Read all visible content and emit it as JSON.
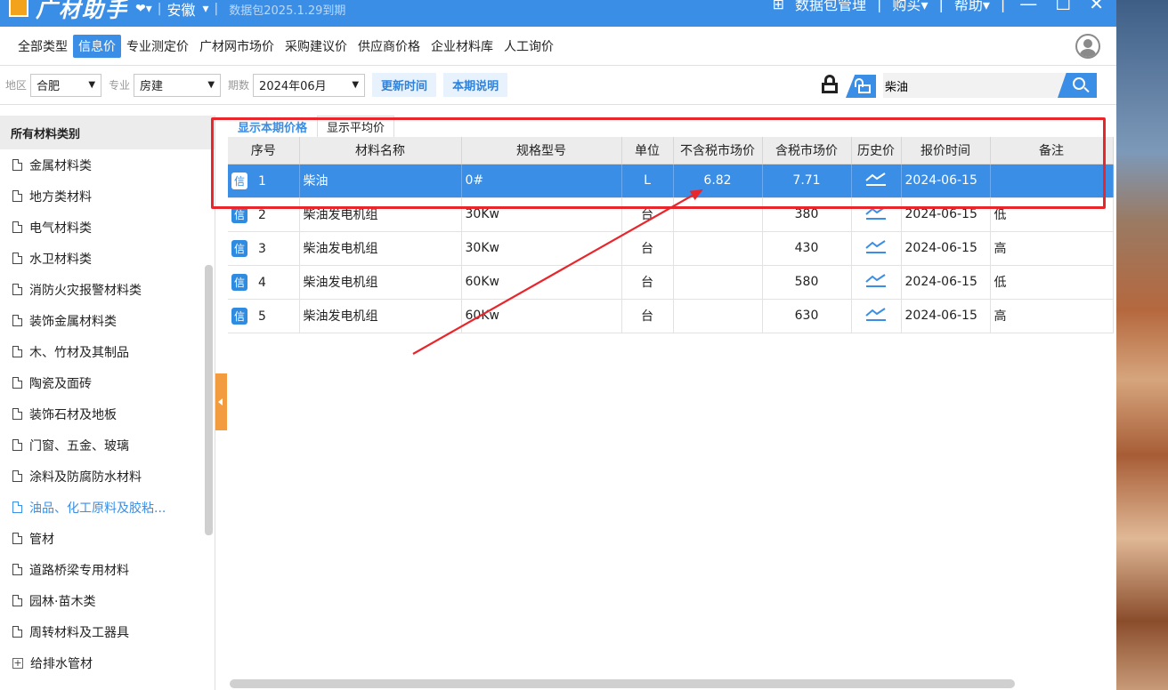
{
  "window": {
    "app_name": "广材助手",
    "region": "安徽",
    "expire_text": "数据包2025.1.29到期",
    "right_menu": [
      "数据包管理",
      "购买",
      "帮助"
    ],
    "win_controls": [
      "—",
      "☐",
      "✕"
    ]
  },
  "menubar": {
    "items": [
      "全部类型",
      "信息价",
      "专业测定价",
      "广材网市场价",
      "采购建议价",
      "供应商价格",
      "企业材料库",
      "人工询价"
    ],
    "active_index": 1
  },
  "filters": {
    "region_label": "地区",
    "region_value": "合肥",
    "major_label": "专业",
    "major_value": "房建",
    "period_label": "期数",
    "period_value": "2024年06月",
    "update_time_label": "更新时间",
    "period_note_label": "本期说明",
    "search_value": "柴油"
  },
  "sidebar": {
    "header": "所有材料类别",
    "items": [
      {
        "label": "金属材料类",
        "type": "doc"
      },
      {
        "label": "地方类材料",
        "type": "doc"
      },
      {
        "label": "电气材料类",
        "type": "doc"
      },
      {
        "label": "水卫材料类",
        "type": "doc"
      },
      {
        "label": "消防火灾报警材料类",
        "type": "doc"
      },
      {
        "label": "装饰金属材料类",
        "type": "doc"
      },
      {
        "label": "木、竹材及其制品",
        "type": "doc"
      },
      {
        "label": "陶瓷及面砖",
        "type": "doc"
      },
      {
        "label": "装饰石材及地板",
        "type": "doc"
      },
      {
        "label": "门窗、五金、玻璃",
        "type": "doc"
      },
      {
        "label": "涂料及防腐防水材料",
        "type": "doc"
      },
      {
        "label": "油品、化工原料及胶粘...",
        "type": "doc",
        "active": true
      },
      {
        "label": "管材",
        "type": "doc"
      },
      {
        "label": "道路桥梁专用材料",
        "type": "doc"
      },
      {
        "label": "园林·苗木类",
        "type": "doc"
      },
      {
        "label": "周转材料及工器具",
        "type": "doc"
      },
      {
        "label": "给排水管材",
        "type": "plus"
      }
    ]
  },
  "tabs": [
    "显示本期价格",
    "显示平均价"
  ],
  "table": {
    "columns": [
      "序号",
      "材料名称",
      "规格型号",
      "单位",
      "不含税市场价",
      "含税市场价",
      "历史价",
      "报价时间",
      "备注"
    ],
    "badge": "信",
    "rows": [
      {
        "no": "1",
        "name": "柴油",
        "spec": "0#",
        "unit": "L",
        "price_ex": "6.82",
        "price_in": "7.71",
        "date": "2024-06-15",
        "note": "",
        "selected": true
      },
      {
        "no": "2",
        "name": "柴油发电机组",
        "spec": "30Kw",
        "unit": "台",
        "price_ex": "",
        "price_in": "380",
        "date": "2024-06-15",
        "note": "低"
      },
      {
        "no": "3",
        "name": "柴油发电机组",
        "spec": "30Kw",
        "unit": "台",
        "price_ex": "",
        "price_in": "430",
        "date": "2024-06-15",
        "note": "高"
      },
      {
        "no": "4",
        "name": "柴油发电机组",
        "spec": "60Kw",
        "unit": "台",
        "price_ex": "",
        "price_in": "580",
        "date": "2024-06-15",
        "note": "低"
      },
      {
        "no": "5",
        "name": "柴油发电机组",
        "spec": "60Kw",
        "unit": "台",
        "price_ex": "",
        "price_in": "630",
        "date": "2024-06-15",
        "note": "高"
      }
    ]
  },
  "colors": {
    "accent": "#3a8ee6",
    "annotation": "#e8262c",
    "collapse_tab": "#f39b3f"
  }
}
